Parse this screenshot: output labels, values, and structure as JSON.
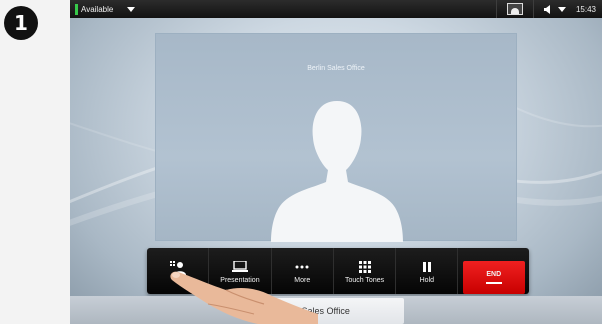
{
  "step": {
    "number": "1"
  },
  "status_bar": {
    "presence": "Available",
    "time": "15:43"
  },
  "remote": {
    "name": "Berlin Sales Office"
  },
  "toolbar": {
    "buttons": [
      {
        "label": "",
        "icon": "add-participant-icon"
      },
      {
        "label": "Presentation",
        "icon": "laptop-icon"
      },
      {
        "label": "More",
        "icon": "ellipsis-icon"
      },
      {
        "label": "Touch Tones",
        "icon": "keypad-icon"
      },
      {
        "label": "Hold",
        "icon": "pause-icon"
      }
    ],
    "end_label": "END"
  },
  "callee_card": {
    "name": "lin Sales Office"
  },
  "colors": {
    "end": "#e00000",
    "presence": "#37c84a",
    "toolbar": "#0d0d0d"
  }
}
